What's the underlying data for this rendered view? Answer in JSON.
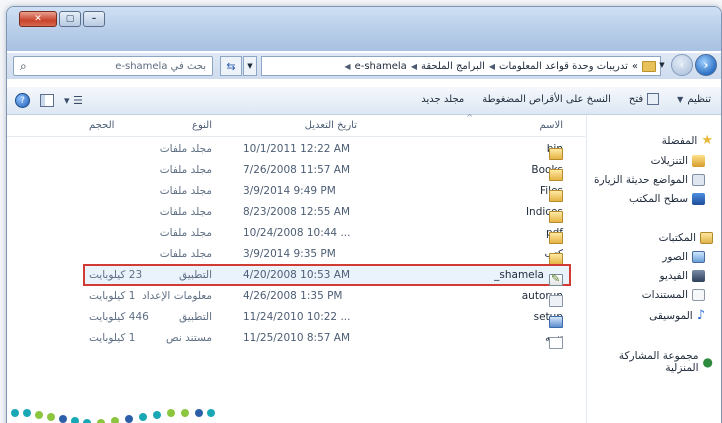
{
  "search": {
    "placeholder": "بحث في e-shamela"
  },
  "path": {
    "segments": [
      "تدريبات وحدة قواعد المعلومات",
      "البرامج الملحقة",
      "e-shamela"
    ],
    "prefix": "«"
  },
  "toolbar": {
    "organize": "تنظيم",
    "open": "فتح",
    "burn": "النسخ على الأقراص المضغوطة",
    "new_folder": "مجلد جديد"
  },
  "nav": {
    "favorites": {
      "title": "المفضلة",
      "items": [
        "التنزيلات",
        "المواضع حديثة الزيارة",
        "سطح المكتب"
      ]
    },
    "libraries": {
      "title": "المكتبات",
      "items": [
        "الصور",
        "الفيديو",
        "المستندات",
        "الموسيقى"
      ]
    },
    "homegroup": "مجموعة المشاركة المنزلية"
  },
  "columns": {
    "name": "الاسم",
    "date": "تاريخ التعديل",
    "type": "النوع",
    "size": "الحجم"
  },
  "files": [
    {
      "name": "bin",
      "date": "10/1/2011 12:22 AM",
      "type": "مجلد ملفات",
      "size": "",
      "icon": "folder-icon"
    },
    {
      "name": "Books",
      "date": "7/26/2008 11:57 AM",
      "type": "مجلد ملفات",
      "size": "",
      "icon": "folder-icon"
    },
    {
      "name": "Files",
      "date": "3/9/2014 9:49 PM",
      "type": "مجلد ملفات",
      "size": "",
      "icon": "folder-icon"
    },
    {
      "name": "Indices",
      "date": "8/23/2008 12:55 AM",
      "type": "مجلد ملفات",
      "size": "",
      "icon": "folder-icon"
    },
    {
      "name": "pdf",
      "date": "10/24/2008 10:44 ...",
      "type": "مجلد ملفات",
      "size": "",
      "icon": "folder-icon"
    },
    {
      "name": "كتب",
      "date": "3/9/2014 9:35 PM",
      "type": "مجلد ملفات",
      "size": "",
      "icon": "folder-icon"
    },
    {
      "name": "shamela_",
      "date": "4/20/2008 10:53 AM",
      "type": "التطبيق",
      "size": "23 كيلوبايت",
      "icon": "application-icon",
      "highlighted": true
    },
    {
      "name": "autorun",
      "date": "4/26/2008 1:35 PM",
      "type": "معلومات الإعداد",
      "size": "1 كيلوبايت",
      "icon": "settings-file-icon"
    },
    {
      "name": "setup",
      "date": "11/24/2010 10:22 ...",
      "type": "التطبيق",
      "size": "446 كيلوبايت",
      "icon": "setup-icon"
    },
    {
      "name": "تنبيه",
      "date": "11/25/2010 8:57 AM",
      "type": "مستند نص",
      "size": "1 كيلوبايت",
      "icon": "text-file-icon"
    }
  ],
  "colors": {
    "highlight_border": "#d23b33",
    "titlebar": "#b7cde8",
    "logo_teal": "#1aa7b5",
    "logo_green": "#8cc63f",
    "logo_blue": "#2d5fa8"
  }
}
